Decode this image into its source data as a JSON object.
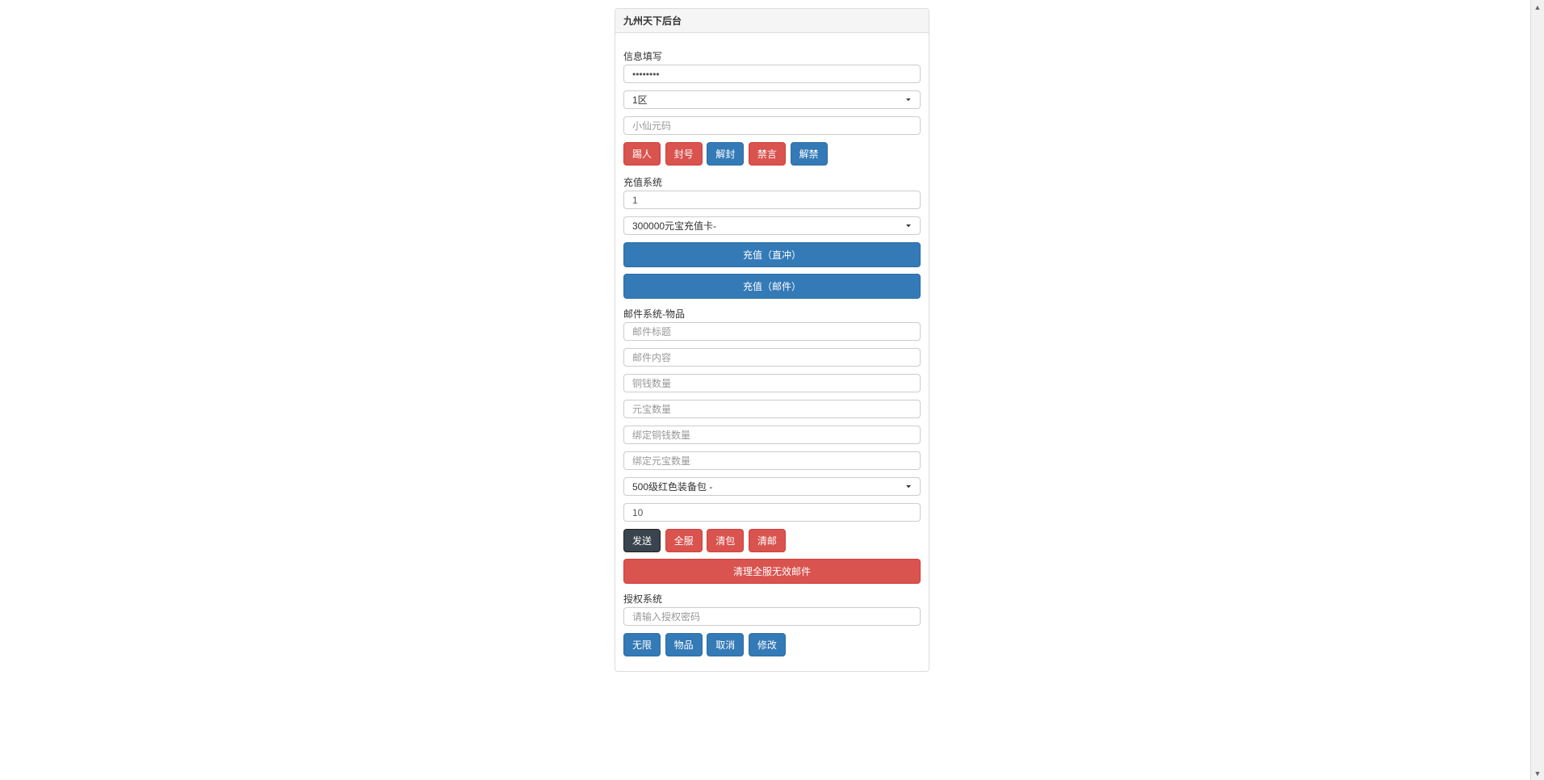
{
  "panel": {
    "title": "九州天下后台"
  },
  "sections": {
    "info": {
      "label": "信息填写"
    },
    "recharge": {
      "label": "充值系统"
    },
    "mail": {
      "label": "邮件系统-物品"
    },
    "auth": {
      "label": "授权系统"
    }
  },
  "info_fields": {
    "password_value": "••••••••",
    "zone_selected": "1区",
    "player_placeholder": "小仙元码"
  },
  "info_buttons": {
    "kick": "踢人",
    "ban": "封号",
    "unban": "解封",
    "mute": "禁言",
    "unmute": "解禁"
  },
  "recharge_fields": {
    "qty_value": "1",
    "card_selected": "300000元宝充值卡-"
  },
  "recharge_buttons": {
    "direct": "充值（直冲）",
    "mail": "充值（邮件）"
  },
  "mail_fields": {
    "title_placeholder": "邮件标题",
    "body_placeholder": "邮件内容",
    "copper_placeholder": "铜钱数量",
    "gold_placeholder": "元宝数量",
    "bind_copper_placeholder": "绑定铜钱数量",
    "bind_gold_placeholder": "绑定元宝数量",
    "item_selected": "500级红色装备包 -",
    "item_qty_value": "10"
  },
  "mail_buttons": {
    "send": "发送",
    "allserver": "全服",
    "clearbag": "清包",
    "clearmail": "清邮",
    "clear_invalid": "清理全服无效邮件"
  },
  "auth_fields": {
    "pwd_placeholder": "请输入授权密码"
  },
  "auth_buttons": {
    "unlimited": "无限",
    "items": "物品",
    "cancel": "取消",
    "modify": "修改"
  }
}
